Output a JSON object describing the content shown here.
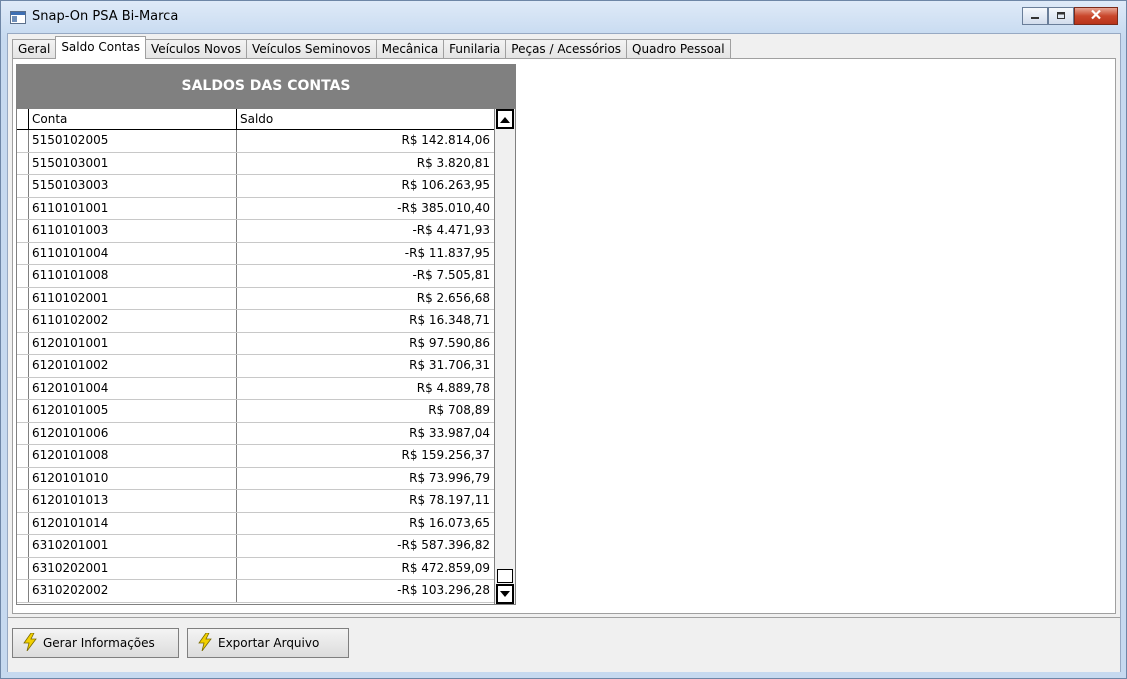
{
  "window": {
    "title": "Snap-On PSA Bi-Marca"
  },
  "tabs": [
    "Geral",
    "Saldo Contas",
    "Veículos Novos",
    "Veículos Seminovos",
    "Mecânica",
    "Funilaria",
    "Peças / Acessórios",
    "Quadro Pessoal"
  ],
  "active_tab": "Saldo Contas",
  "panel": {
    "title": "SALDOS DAS CONTAS",
    "columns": [
      "Conta",
      "Saldo"
    ],
    "rows": [
      [
        "5150102005",
        "R$ 142.814,06"
      ],
      [
        "5150103001",
        "R$ 3.820,81"
      ],
      [
        "5150103003",
        "R$ 106.263,95"
      ],
      [
        "6110101001",
        "-R$ 385.010,40"
      ],
      [
        "6110101003",
        "-R$ 4.471,93"
      ],
      [
        "6110101004",
        "-R$ 11.837,95"
      ],
      [
        "6110101008",
        "-R$ 7.505,81"
      ],
      [
        "6110102001",
        "R$ 2.656,68"
      ],
      [
        "6110102002",
        "R$ 16.348,71"
      ],
      [
        "6120101001",
        "R$ 97.590,86"
      ],
      [
        "6120101002",
        "R$ 31.706,31"
      ],
      [
        "6120101004",
        "R$ 4.889,78"
      ],
      [
        "6120101005",
        "R$ 708,89"
      ],
      [
        "6120101006",
        "R$ 33.987,04"
      ],
      [
        "6120101008",
        "R$ 159.256,37"
      ],
      [
        "6120101010",
        "R$ 73.996,79"
      ],
      [
        "6120101013",
        "R$ 78.197,11"
      ],
      [
        "6120101014",
        "R$ 16.073,65"
      ],
      [
        "6310201001",
        "-R$ 587.396,82"
      ],
      [
        "6310202001",
        "R$ 472.859,09"
      ],
      [
        "6310202002",
        "-R$ 103.296,28"
      ]
    ]
  },
  "buttons": {
    "gerar": "Gerar Informações",
    "exportar": "Exportar Arquivo"
  },
  "icons": {
    "app": "app-window-icon",
    "minimize": "minimize-icon",
    "maximize": "maximize-icon",
    "close": "close-icon",
    "button": "lightning-icon"
  },
  "colors": {
    "header_bg": "#808080",
    "close_button": "#c9462c",
    "lightning": "#f2d000"
  }
}
